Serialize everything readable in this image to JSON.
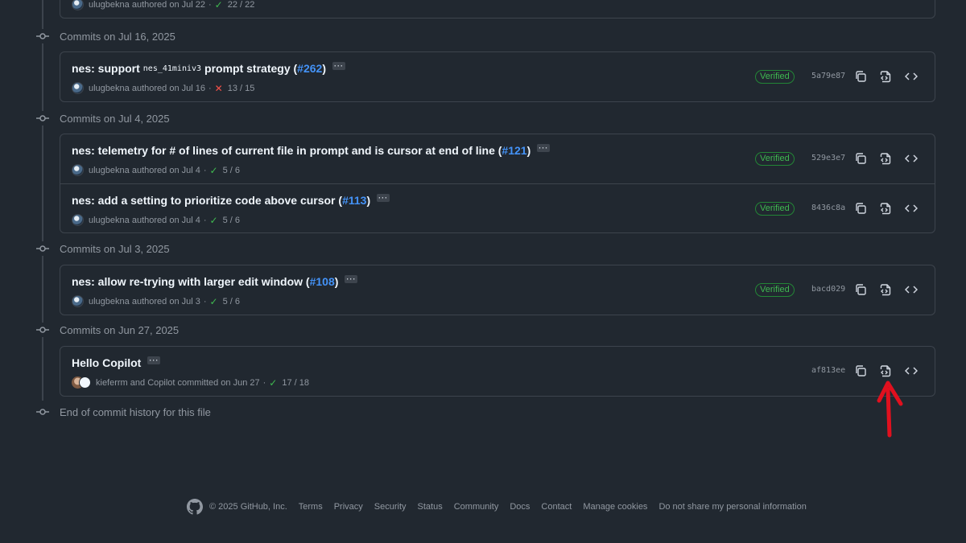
{
  "groups": [
    {
      "header": "",
      "commits": [
        {
          "author": "ulugbekna",
          "authored": "authored on Jul 22",
          "status": "22 / 22"
        }
      ]
    },
    {
      "header": "Commits on Jul 16, 2025",
      "commits": [
        {
          "title_pre": "nes: support",
          "title_code": "nes_41miniv3",
          "title_post": "prompt strategy (",
          "pr": "#262",
          "title_end": ")",
          "author": "ulugbekna",
          "authored": "authored on Jul 16",
          "status": "13 / 15",
          "verified": "Verified",
          "sha": "5a79e87"
        }
      ]
    },
    {
      "header": "Commits on Jul 4, 2025",
      "commits": [
        {
          "title_pre": "nes: telemetry for # of lines of current file in prompt and is cursor at end of line (",
          "pr": "#121",
          "title_end": ")",
          "author": "ulugbekna",
          "authored": "authored on Jul 4",
          "status": "5 / 6",
          "verified": "Verified",
          "sha": "529e3e7"
        },
        {
          "title_pre": "nes: add a setting to prioritize code above cursor (",
          "pr": "#113",
          "title_end": ")",
          "author": "ulugbekna",
          "authored": "authored on Jul 4",
          "status": "5 / 6",
          "verified": "Verified",
          "sha": "8436c8a"
        }
      ]
    },
    {
      "header": "Commits on Jul 3, 2025",
      "commits": [
        {
          "title_pre": "nes: allow re-trying with larger edit window (",
          "pr": "#108",
          "title_end": ")",
          "author": "ulugbekna",
          "authored": "authored on Jul 3",
          "status": "5 / 6",
          "verified": "Verified",
          "sha": "bacd029"
        }
      ]
    },
    {
      "header": "Commits on Jun 27, 2025",
      "commits": [
        {
          "title_pre": "Hello Copilot",
          "author": "kieferrm and Copilot",
          "authored": "committed on Jun 27",
          "status": "17 / 18",
          "sha": "af813ee"
        }
      ]
    }
  ],
  "end_text": "End of commit history for this file",
  "footer": {
    "copyright": "© 2025 GitHub, Inc.",
    "links": [
      "Terms",
      "Privacy",
      "Security",
      "Status",
      "Community",
      "Docs",
      "Contact",
      "Manage cookies",
      "Do not share my personal information"
    ]
  },
  "icons": {
    "commit_node": "git-commit-icon",
    "copy": "copy-icon",
    "browse": "file-code-icon",
    "code": "code-icon",
    "logo": "github-mark-icon",
    "annotation": "red-arrow-icon"
  },
  "colors": {
    "background": "#212830",
    "border": "#3d444d",
    "link": "#4493f8",
    "success": "#3fb950",
    "danger": "#f85149",
    "annotation": "#e0101e"
  }
}
